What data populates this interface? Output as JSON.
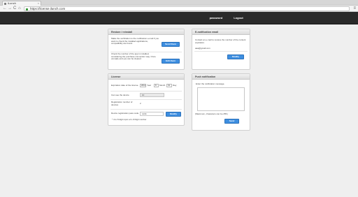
{
  "browser": {
    "tab_title": "iLunch",
    "tab_close": "×",
    "back": "←",
    "forward": "→",
    "reload": "C",
    "home": "⌂",
    "url": "https://license.ilunch.com",
    "menu": "≡"
  },
  "appbar": {
    "password": "password",
    "logout": "Logout"
  },
  "restore_panel": {
    "title": "Restore / reinstall",
    "block1_text": "Make the verification to the notification e-mail if you want to check the installed applications, compatibility are found.",
    "block1_button": "Send them",
    "block2_text": "Check the number of the app is installed, considering the purchase connection way. Once unmade and you can be cleared",
    "block2_button": "Edit them"
  },
  "license_panel": {
    "title": "License",
    "expiration_label": "Expiration date of the license",
    "year_value": "2011",
    "year_unit": "Year",
    "month_value": "8",
    "month_unit": "Month",
    "day_value": "31",
    "day_unit": "Day",
    "device_label": "Can see the device",
    "device_value": "10",
    "reg_label": "Registration number of devices",
    "reg_value": "2",
    "pass_label": "Device registration pass code",
    "pass_value": "1234",
    "pass_button": "Modify",
    "note": "* 4 to 8 digit input a 0~9 Digit number"
  },
  "email_panel": {
    "title": "E-notification email",
    "text": "Contact an e-mail to receive the number of the content expiration.",
    "email_value": "aaa@gmail.com",
    "button": "Modify"
  },
  "push_panel": {
    "title": "Push notification",
    "text": "Enter the notification message.",
    "counter": "(Maximum, characters can be 255.)",
    "button": "Send"
  }
}
